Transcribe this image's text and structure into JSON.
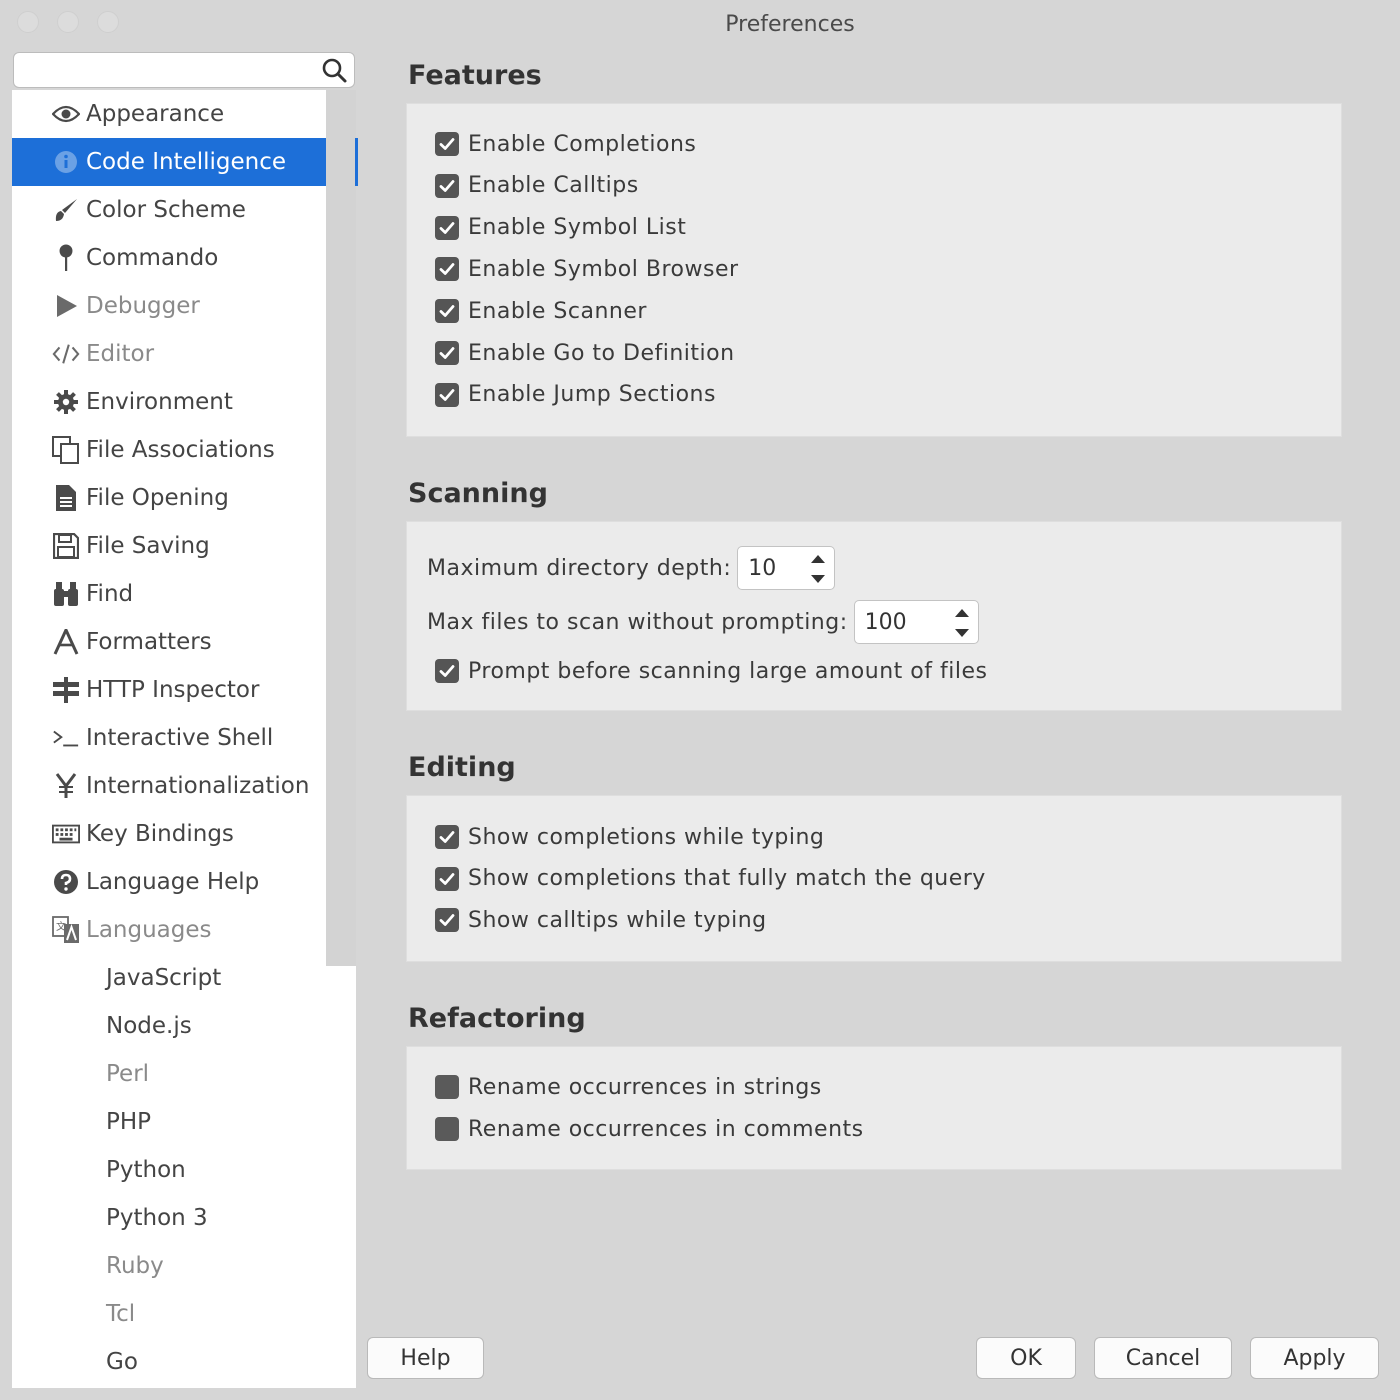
{
  "window": {
    "title": "Preferences"
  },
  "search": {
    "placeholder": "",
    "value": ""
  },
  "sidebar": {
    "items": [
      {
        "label": "Appearance",
        "icon": "eye-icon",
        "selected": false,
        "dim": false
      },
      {
        "label": "Code Intelligence",
        "icon": "info-icon",
        "selected": true,
        "dim": false
      },
      {
        "label": "Color Scheme",
        "icon": "brush-icon",
        "selected": false,
        "dim": false
      },
      {
        "label": "Commando",
        "icon": "pin-icon",
        "selected": false,
        "dim": false
      },
      {
        "label": "Debugger",
        "icon": "play-icon",
        "selected": false,
        "dim": true
      },
      {
        "label": "Editor",
        "icon": "code-icon",
        "selected": false,
        "dim": true
      },
      {
        "label": "Environment",
        "icon": "gear-icon",
        "selected": false,
        "dim": false
      },
      {
        "label": "File Associations",
        "icon": "copy-icon",
        "selected": false,
        "dim": false
      },
      {
        "label": "File Opening",
        "icon": "document-icon",
        "selected": false,
        "dim": false
      },
      {
        "label": "File Saving",
        "icon": "floppy-icon",
        "selected": false,
        "dim": false
      },
      {
        "label": "Find",
        "icon": "binoculars-icon",
        "selected": false,
        "dim": false
      },
      {
        "label": "Formatters",
        "icon": "font-icon",
        "selected": false,
        "dim": false
      },
      {
        "label": "HTTP Inspector",
        "icon": "signpost-icon",
        "selected": false,
        "dim": false
      },
      {
        "label": "Interactive Shell",
        "icon": "terminal-icon",
        "selected": false,
        "dim": false
      },
      {
        "label": "Internationalization",
        "icon": "yen-icon",
        "selected": false,
        "dim": false
      },
      {
        "label": "Key Bindings",
        "icon": "keyboard-icon",
        "selected": false,
        "dim": false
      },
      {
        "label": "Language Help",
        "icon": "question-icon",
        "selected": false,
        "dim": false
      },
      {
        "label": "Languages",
        "icon": "translate-icon",
        "selected": false,
        "dim": true
      }
    ],
    "languages": [
      {
        "label": "JavaScript",
        "dim": false
      },
      {
        "label": "Node.js",
        "dim": false
      },
      {
        "label": "Perl",
        "dim": true
      },
      {
        "label": "PHP",
        "dim": false
      },
      {
        "label": "Python",
        "dim": false
      },
      {
        "label": "Python 3",
        "dim": false
      },
      {
        "label": "Ruby",
        "dim": true
      },
      {
        "label": "Tcl",
        "dim": true
      },
      {
        "label": "Go",
        "dim": false
      }
    ]
  },
  "features": {
    "title": "Features",
    "options": [
      {
        "label": "Enable Completions",
        "checked": true
      },
      {
        "label": "Enable Calltips",
        "checked": true
      },
      {
        "label": "Enable Symbol List",
        "checked": true
      },
      {
        "label": "Enable Symbol Browser",
        "checked": true
      },
      {
        "label": "Enable Scanner",
        "checked": true
      },
      {
        "label": "Enable Go to Definition",
        "checked": true
      },
      {
        "label": "Enable Jump Sections",
        "checked": true
      }
    ]
  },
  "scanning": {
    "title": "Scanning",
    "max_depth_label": "Maximum directory depth:",
    "max_depth_value": "10",
    "max_files_label": "Max files to scan without prompting:",
    "max_files_value": "100",
    "prompt_label": "Prompt before scanning large amount of files",
    "prompt_checked": true
  },
  "editing": {
    "title": "Editing",
    "options": [
      {
        "label": "Show completions while typing",
        "checked": true
      },
      {
        "label": "Show completions that fully match the query",
        "checked": true
      },
      {
        "label": "Show calltips while typing",
        "checked": true
      }
    ]
  },
  "refactoring": {
    "title": "Refactoring",
    "options": [
      {
        "label": "Rename occurrences in strings",
        "checked": false
      },
      {
        "label": "Rename occurrences in comments",
        "checked": false
      }
    ]
  },
  "buttons": {
    "help": "Help",
    "ok": "OK",
    "cancel": "Cancel",
    "apply": "Apply"
  },
  "colors": {
    "accent": "#1d6fd8",
    "panel": "#ebebeb",
    "window": "#d6d6d6"
  }
}
